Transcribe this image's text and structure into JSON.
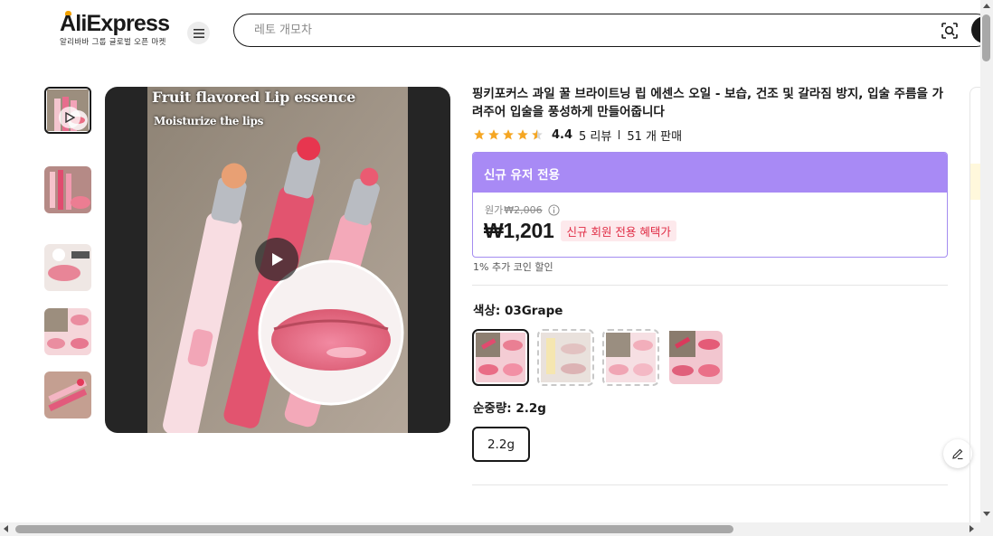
{
  "header": {
    "logo_text": "AliExpress",
    "logo_subtitle": "알리바바 그룹 글로벌 오픈 마켓",
    "search_placeholder": "레토 개모차",
    "menu_icon": "hamburger-menu-icon",
    "image_search_icon": "camera-lens-icon"
  },
  "gallery": {
    "main_caption_1": "Fruit flavored Lip essence",
    "main_caption_2": "Moisturize the lips",
    "thumbnail_count": 5,
    "selected_thumbnail": 1
  },
  "product": {
    "title": "핑키포커스 과일 꿀 브라이트닝 립 에센스 오일 - 보습, 건조 및 갈라짐 방지, 입술 주름을 가려주어 입술을 풍성하게 만들어줍니다",
    "rating": "4.4",
    "stars": 4.5,
    "reviews": "5 리뷰",
    "sold": "51 개 판매"
  },
  "promo": {
    "header": "신규 유저 전용",
    "original_label": "원가",
    "original_price": "₩2,006",
    "price": "₩1,201",
    "badge": "신규 회원 전용 혜택가",
    "coin_note": "1% 추가 코인 할인"
  },
  "options": {
    "color_label": "색상: 03Grape",
    "color_swatch_count": 4,
    "selected_color": 1,
    "weight_label": "순중량: 2.2g",
    "weight_value": "2.2g"
  },
  "colors": {
    "accent_purple": "#a88af5",
    "badge_bg": "#fde9ec",
    "badge_text": "#e02c45",
    "star": "#f5a623"
  }
}
